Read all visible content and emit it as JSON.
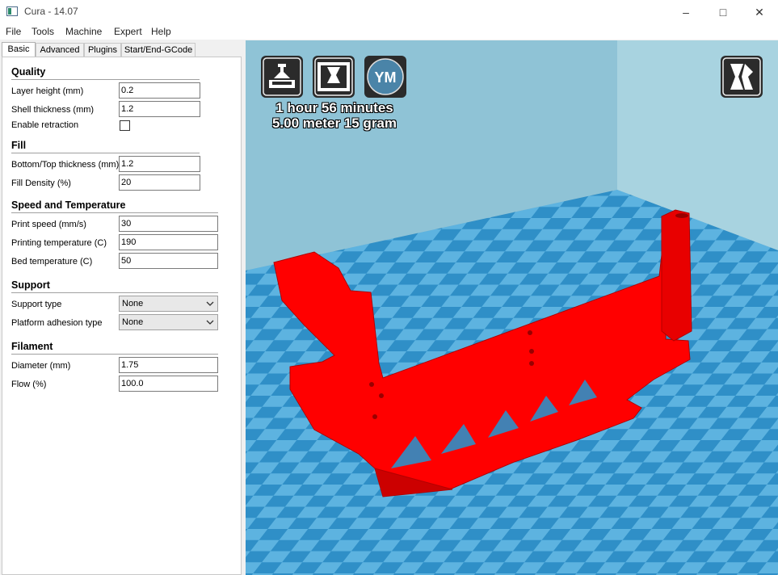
{
  "window": {
    "title": "Cura - 14.07"
  },
  "menu": [
    "File",
    "Tools",
    "Machine",
    "Expert",
    "Help"
  ],
  "tabs": [
    "Basic",
    "Advanced",
    "Plugins",
    "Start/End-GCode"
  ],
  "quality": {
    "heading": "Quality",
    "layer_height_label": "Layer height (mm)",
    "layer_height": "0.2",
    "shell_thickness_label": "Shell thickness (mm)",
    "shell_thickness": "1.2",
    "retraction_label": "Enable retraction"
  },
  "fill": {
    "heading": "Fill",
    "bottom_top_label": "Bottom/Top thickness (mm)",
    "bottom_top": "1.2",
    "density_label": "Fill Density (%)",
    "density": "20"
  },
  "speed": {
    "heading": "Speed and Temperature",
    "print_speed_label": "Print speed (mm/s)",
    "print_speed": "30",
    "print_temp_label": "Printing temperature (C)",
    "print_temp": "190",
    "bed_temp_label": "Bed temperature (C)",
    "bed_temp": "50"
  },
  "support": {
    "heading": "Support",
    "support_type_label": "Support type",
    "support_type": "None",
    "adhesion_label": "Platform adhesion type",
    "adhesion": "None"
  },
  "filament": {
    "heading": "Filament",
    "diameter_label": "Diameter (mm)",
    "diameter": "1.75",
    "flow_label": "Flow (%)",
    "flow": "100.0"
  },
  "viewer": {
    "print_time": "1 hour 56 minutes",
    "material": "5.00 meter 15 gram",
    "ym_label": "YM",
    "model_color": "#ff0000",
    "bed_colors": [
      "#5db3e0",
      "#2f8fc7"
    ]
  }
}
